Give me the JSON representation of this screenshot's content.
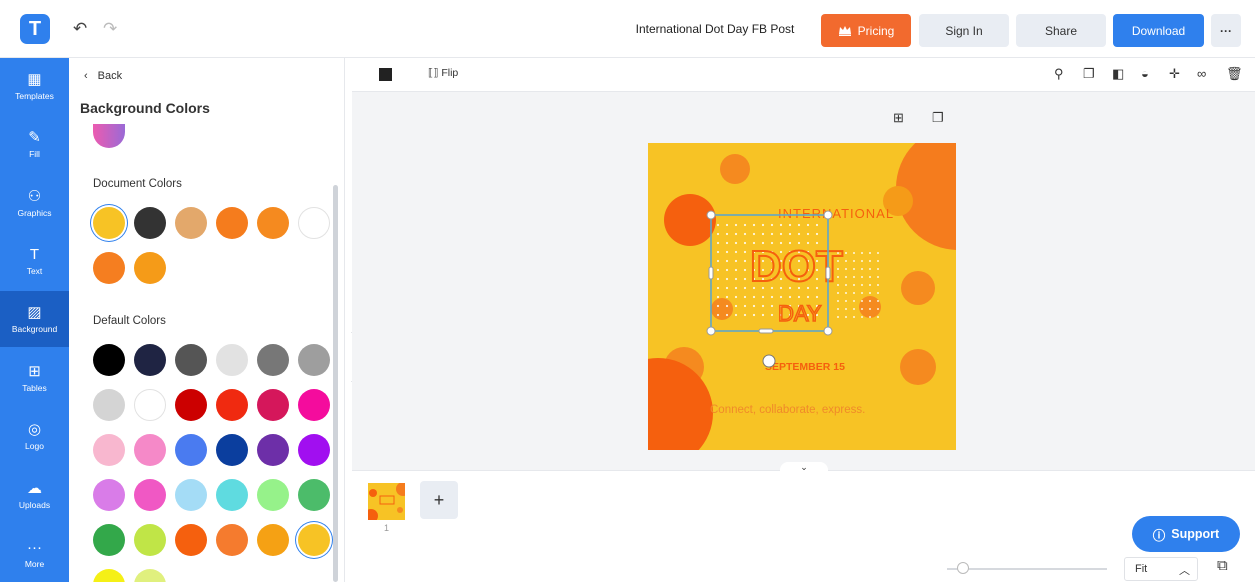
{
  "app": {
    "logo_letter": "T",
    "undo_glyph": "↶",
    "redo_glyph": "↷"
  },
  "header": {
    "document_title": "International Dot Day FB Post",
    "pricing_label": "Pricing",
    "signin_label": "Sign In",
    "share_label": "Share",
    "download_label": "Download",
    "more_label": "···"
  },
  "leftnav": [
    {
      "label": "Templates",
      "icon": "▦",
      "icon_name": "templates-icon"
    },
    {
      "label": "Fill",
      "icon": "✎",
      "icon_name": "fill-icon"
    },
    {
      "label": "Graphics",
      "icon": "⚇",
      "icon_name": "graphics-icon"
    },
    {
      "label": "Text",
      "icon": "T",
      "icon_name": "text-icon"
    },
    {
      "label": "Background",
      "icon": "▨",
      "icon_name": "background-icon"
    },
    {
      "label": "Tables",
      "icon": "⊞",
      "icon_name": "tables-icon"
    },
    {
      "label": "Logo",
      "icon": "◎",
      "icon_name": "logo-icon"
    },
    {
      "label": "Uploads",
      "icon": "☁",
      "icon_name": "uploads-icon"
    },
    {
      "label": "More",
      "icon": "···",
      "icon_name": "more-icon"
    }
  ],
  "panel": {
    "back_label": "Back",
    "title": "Background Colors",
    "document_colors_title": "Document Colors",
    "default_colors_title": "Default Colors",
    "document_colors": [
      "#f7c325",
      "#333333",
      "#e3a86b",
      "#f57c1d",
      "#f58a1f",
      "#ffffff",
      "#f57e20",
      "#f59b18"
    ],
    "default_colors": [
      "#000000",
      "#1f2443",
      "#555555",
      "#e2e2e2",
      "#777777",
      "#9e9e9e",
      "#d4d4d4",
      "#ffffff",
      "#cc0000",
      "#f02a10",
      "#d5175b",
      "#f40c9d",
      "#f8b7cf",
      "#f589c8",
      "#4a7bf0",
      "#0b3e9e",
      "#6d2fa8",
      "#a10ff0",
      "#d97ce8",
      "#f058c4",
      "#a4dcf6",
      "#5fdbe0",
      "#96f28a",
      "#4cbc6a",
      "#33a84a",
      "#c0e547",
      "#f5600e",
      "#f57b2e",
      "#f5a114",
      "#f7c325",
      "#f5f016",
      "#e0f07e"
    ]
  },
  "toolbar": {
    "flip_label": "Flip"
  },
  "canvas": {
    "title_text": "INTERNATIONAL",
    "dot_text": "DOT",
    "day_text": "DAY",
    "date_text": "SEPTEMBER 15",
    "tagline": "Connect, collaborate, express.",
    "bg_color": "#f7c325",
    "accent": "#f57c1d"
  },
  "bottom": {
    "page_number": "1",
    "add_label": "+",
    "support_label": "Support",
    "zoom_value": "Fit"
  }
}
